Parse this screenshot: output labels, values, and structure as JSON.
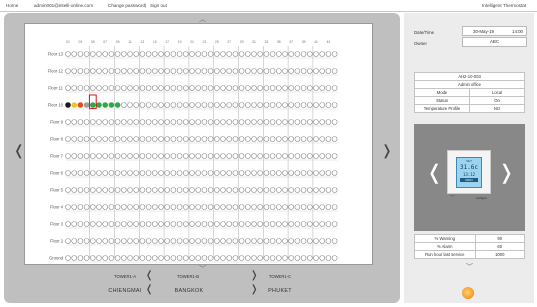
{
  "topbar": {
    "home": "Home",
    "email": "admin001@intelli-online.com",
    "change_password": "Change password",
    "separator": "|",
    "sign_out": "Sign out",
    "brand": "Intelligent Thermostat"
  },
  "building": {
    "unit_numbers": [
      "01",
      "02",
      "03",
      "04",
      "05",
      "06",
      "07",
      "08",
      "09",
      "10",
      "11",
      "12",
      "13",
      "14",
      "15",
      "16",
      "17",
      "18",
      "19",
      "20",
      "21",
      "22",
      "23",
      "24",
      "25",
      "26",
      "27",
      "28",
      "29",
      "30",
      "31",
      "32",
      "33",
      "34",
      "35",
      "36",
      "37",
      "38",
      "39",
      "40",
      "41",
      "42",
      "43",
      "44",
      "45",
      "46",
      "47",
      "48",
      "49",
      "50",
      "51",
      "52",
      "53",
      "54",
      "55",
      "56",
      "57",
      "58",
      "59",
      "60",
      "61",
      "62",
      "63",
      "64",
      "65",
      "66"
    ],
    "floors": [
      "Floor 13",
      "Floor 12",
      "Floor 11",
      "Floor 10",
      "Floor 9",
      "Floor 8",
      "Floor 7",
      "Floor 6",
      "Floor 5",
      "Floor 4",
      "Floor 3",
      "Floor 2",
      "Ground"
    ],
    "active_floor": "Floor 10",
    "status_colors": {
      "offline": "#1a1a1a",
      "warning": "#f2c12e",
      "alarm": "#e8491d",
      "idle": "#9aa0a6",
      "normal": "#2ea84a",
      "empty": "#ffffff"
    },
    "floor10_status": [
      "offline",
      "warning",
      "alarm",
      "idle",
      "normal",
      "normal",
      "normal",
      "normal",
      "normal"
    ],
    "towers": [
      "TOWER1-A",
      "TOWER1-B",
      "TOWER1-C"
    ],
    "cities": [
      "CHIENGMAI",
      "BANGKOK",
      "PHUKET"
    ]
  },
  "nav": {
    "left": "❬",
    "right": "❭",
    "up": "︿",
    "down": "﹀",
    "tower_left": "❬",
    "tower_right": "❭"
  },
  "right_panel": {
    "datetime_label": "Date/Time",
    "date": "30-May-19",
    "time": "14:00",
    "owner_label": "Owner",
    "owner": "ABC",
    "device_id": "AH2-10-003",
    "device_location": "Admin office",
    "rows": [
      {
        "label": "Mode",
        "value": "Local"
      },
      {
        "label": "Status",
        "value": "On"
      },
      {
        "label": "Temperature Profile",
        "value": "NO"
      }
    ],
    "thermostat": {
      "set_label": "SET",
      "temperature": "31.6c",
      "time": "13:12",
      "day": "MON",
      "brand": "intelligent"
    },
    "stats": [
      {
        "label": "% Warning",
        "value": "90"
      },
      {
        "label": "% Alarm",
        "value": "60"
      },
      {
        "label": "Run hour last service",
        "value": "1000"
      }
    ],
    "footer_logo_text": "intelli-online"
  }
}
